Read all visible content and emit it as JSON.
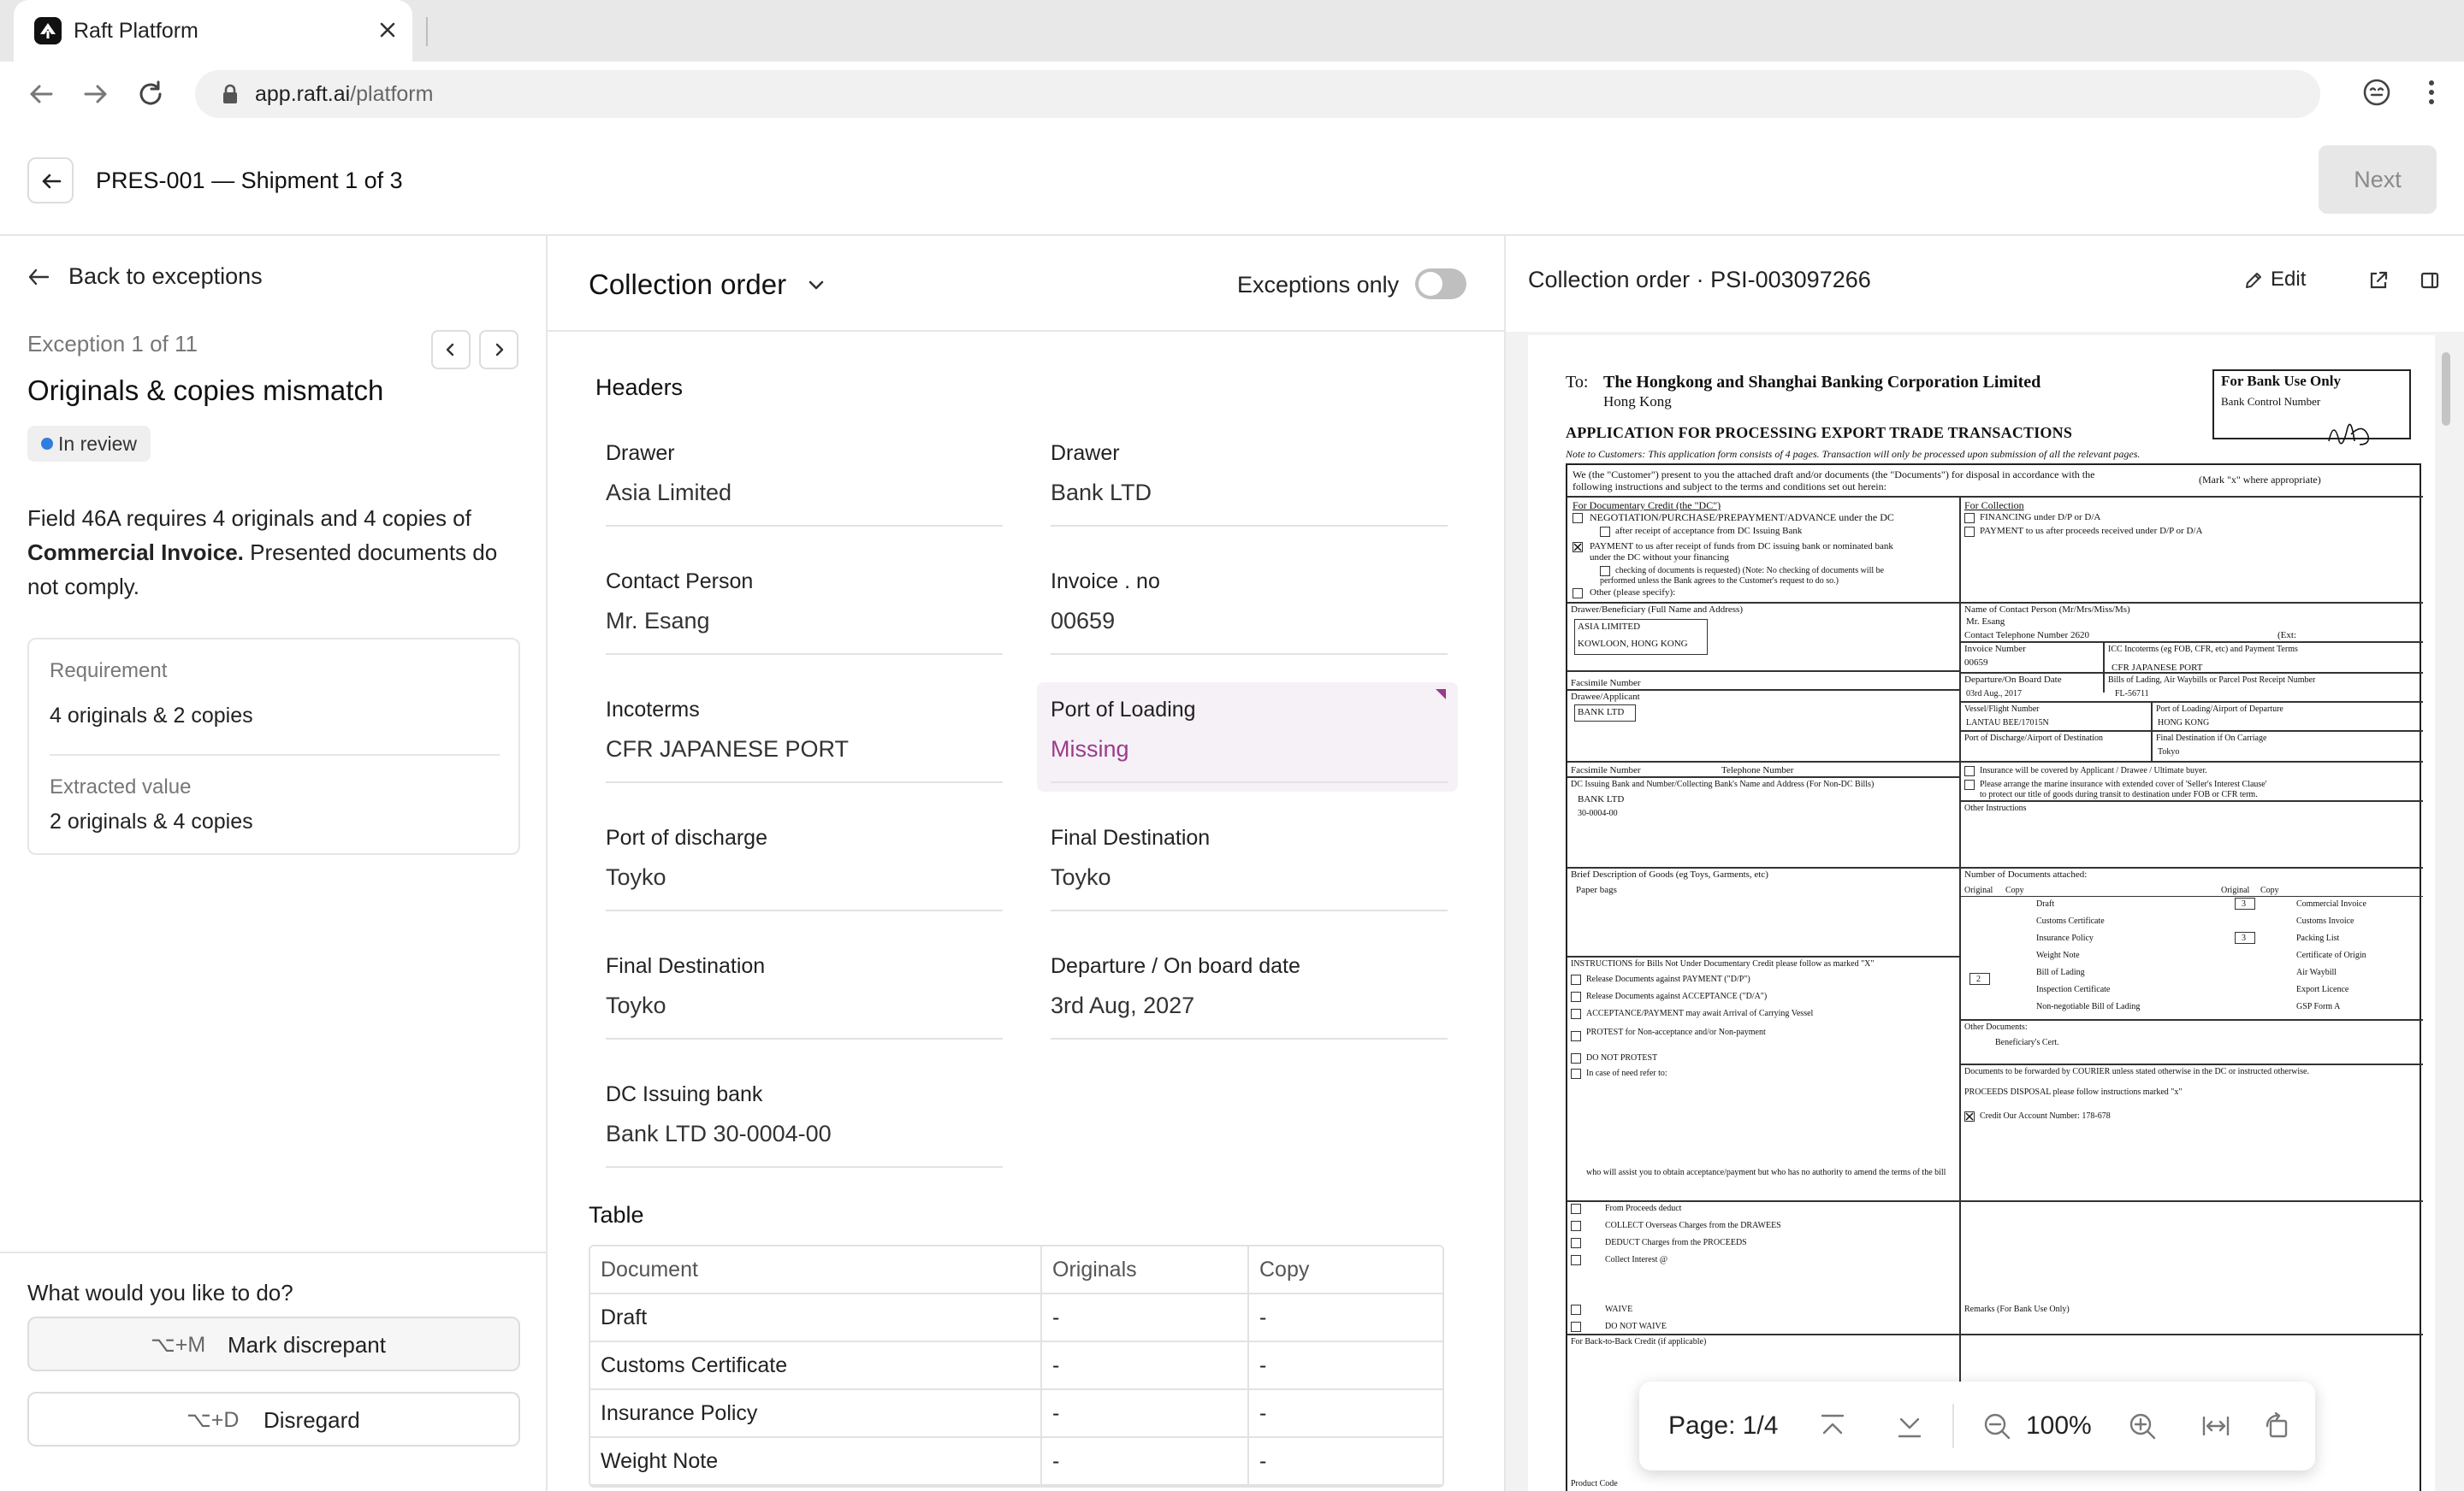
{
  "browser": {
    "tab_title": "Raft Platform",
    "url_host": "app.raft.ai",
    "url_path": "/platform"
  },
  "header": {
    "title": "PRES-001 — Shipment 1 of 3",
    "next_label": "Next"
  },
  "left": {
    "back_label": "Back to exceptions",
    "exception_count": "Exception 1 of 11",
    "exception_title": "Originals & copies mismatch",
    "status": "In review",
    "desc_pre": "Field 46A requires 4 originals and 4 copies of ",
    "desc_bold": "Commercial Invoice.",
    "desc_post": " Presented documents do not comply.",
    "requirement_label": "Requirement",
    "requirement_value": "4 originals & 2 copies",
    "extracted_label": "Extracted value",
    "extracted_value": "2 originals & 4 copies",
    "question": "What would you like to do?",
    "actions": [
      {
        "shortcut": "⌥+M",
        "label": "Mark discrepant"
      },
      {
        "shortcut": "⌥+D",
        "label": "Disregard"
      }
    ]
  },
  "middle": {
    "doc_type": "Collection order",
    "exceptions_only_label": "Exceptions only",
    "exceptions_only": false,
    "headers_title": "Headers",
    "fields": [
      {
        "label": "Drawer",
        "value": "Asia Limited"
      },
      {
        "label": "Drawer",
        "value": "Bank LTD"
      },
      {
        "label": "Contact Person",
        "value": "Mr. Esang"
      },
      {
        "label": "Invoice . no",
        "value": "00659"
      },
      {
        "label": "Incoterms",
        "value": "CFR JAPANESE PORT"
      },
      {
        "label": "Port of Loading",
        "value": "Missing"
      },
      {
        "label": "Port of discharge",
        "value": "Toyko"
      },
      {
        "label": "Final Destination",
        "value": "Toyko"
      },
      {
        "label": "Final Destination",
        "value": "Toyko"
      },
      {
        "label": "Departure / On board date",
        "value": "3rd Aug, 2027"
      },
      {
        "label": "DC Issuing bank",
        "value": "Bank LTD 30-0004-00"
      }
    ],
    "table_title": "Table",
    "table": {
      "columns": [
        "Document",
        "Originals",
        "Copy"
      ],
      "rows": [
        [
          "Draft",
          "-",
          "-"
        ],
        [
          "Customs Certificate",
          "-",
          "-"
        ],
        [
          "Insurance Policy",
          "-",
          "-"
        ],
        [
          "Weight Note",
          "-",
          "-"
        ]
      ]
    }
  },
  "right": {
    "title": "Collection order · PSI-003097266",
    "edit_label": "Edit",
    "page_label": "Page: 1/4",
    "zoom": "100%",
    "pdf": {
      "to": "To:",
      "bank": "The Hongkong and Shanghai Banking Corporation Limited",
      "city": "Hong Kong",
      "bank_use": "For Bank Use Only",
      "bank_control": "Bank Control Number",
      "app_title": "APPLICATION FOR PROCESSING EXPORT TRADE TRANSACTIONS",
      "note": "Note to Customers:   This application form consists of 4 pages.   Transaction will only be processed upon submission of all the relevant pages.",
      "intro1": "We (the \"Customer\") present to you the attached draft and/or documents (the \"Documents\") for disposal in accordance with the",
      "intro2": "following instructions and subject to the terms and conditions set out herein:",
      "mark": "(Mark \"x\" where appropriate)",
      "for_dc": "For Documentary Credit (the \"DC\")",
      "negotiation": "NEGOTIATION/PURCHASE/PREPAYMENT/ADVANCE under the DC",
      "after_receipt": "after receipt of acceptance from DC Issuing Bank",
      "payment_dc": "PAYMENT to us after receipt of funds from DC issuing bank or nominated bank",
      "under_dc": "under the DC without your financing",
      "checking": "checking of documents is requested) (Note: No checking of documents will be",
      "performed": "performed unless the Bank agrees to the Customer's request to do so.)",
      "other": "Other (please specify):",
      "for_collection": "For Collection",
      "financing": "FINANCING under D/P or D/A",
      "payment_coll": "PAYMENT to us after proceeds received under D/P or D/A",
      "drawer_label": "Drawer/Beneficiary (Full Name and Address)",
      "drawer_value1": "ASIA LIMITED",
      "drawer_value2": "KOWLOON, HONG KONG",
      "contact_label": "Name of Contact Person (Mr/Mrs/Miss/Ms)",
      "contact_value": "Mr. Esang",
      "tel_label": "Contact Telephone Number 2620",
      "ext": "(Ext:",
      "invoice_label": "Invoice Number",
      "invoice_value": "00659",
      "icc_label": "ICC Incoterms (eg FOB, CFR, etc) and Payment Terms",
      "icc_value": "CFR JAPANESE PORT",
      "facsimile": "Facsimile Number",
      "departure_label": "Departure/On Board Date",
      "departure_value": "03rd Aug., 2017",
      "bl_label": "Bills of Lading, Air Waybills or Parcel Post Receipt Number",
      "bl_value": "FL-56711",
      "drawee_label": "Drawee/Applicant",
      "drawee_value": "BANK LTD",
      "vessel_label": "Vessel/Flight Number",
      "vessel_value": "LANTAU BEE/17015N",
      "pol_label": "Port of Loading/Airport of Departure",
      "pol_value": "HONG KONG",
      "pod_label": "Port of Discharge/Airport of Destination",
      "final_label": "Final Destination if On Carriage",
      "final_value": "Tokyo",
      "pod_value": "Tokyo",
      "tel_num": "Telephone Number",
      "insurance1": "Insurance will be covered by Applicant / Drawee / Ultimate buyer.",
      "insurance2": "Please arrange the marine insurance with extended cover of 'Seller's Interest Clause'",
      "insurance3": "to protect our title of goods during transit to destination under FOB or CFR term.",
      "dc_issuing_label": "DC Issuing Bank and Number/Collecting Bank's Name and Address (For Non-DC Bills)",
      "dc_issuing_value1": "BANK LTD",
      "dc_issuing_value2": "30-0004-00",
      "other_instr": "Other Instructions",
      "goods_label": "Brief Description of Goods (eg Toys, Garments, etc)",
      "goods_value": "Paper bags",
      "num_docs": "Number of Documents attached:",
      "original": "Original",
      "copy": "Copy",
      "docs_left": [
        "Draft",
        "Customs Certificate",
        "Insurance Policy",
        "Weight Note",
        "Bill of Lading",
        "Inspection Certificate",
        "Non-negotiable Bill of Lading"
      ],
      "docs_right": [
        "Commercial Invoice",
        "Customs Invoice",
        "Packing List",
        "Certificate of Origin",
        "Air Waybill",
        "Export Licence",
        "GSP Form A"
      ],
      "draft_orig": "3",
      "insurance_orig": "3",
      "bol_orig": "2",
      "instructions": "INSTRUCTIONS for Bills Not Under Documentary Credit please follow as marked \"X\"",
      "instr_a": "Release Documents against PAYMENT (\"D/P\")",
      "instr_b": "Release Documents against ACCEPTANCE (\"D/A\")",
      "instr_c": "ACCEPTANCE/PAYMENT may await Arrival of Carrying Vessel",
      "instr_d": "PROTEST for Non-acceptance and/or Non-payment",
      "instr_e": "DO NOT PROTEST",
      "instr_f": "In case of need refer to:",
      "other_docs": "Other Documents:",
      "bene_cert": "Beneficiary's Cert.",
      "courier": "Documents to be forwarded by COURIER unless stated otherwise in the DC or instructed otherwise.",
      "proceeds": "PROCEEDS DISPOSAL please follow instructions marked \"x\"",
      "credit_acct": "Credit Our Account Number: 178-678",
      "assist": "who will assist you to obtain acceptance/payment but who has no authority to amend the terms of the bill",
      "instr_g": "From Proceeds deduct",
      "instr_h": "COLLECT Overseas Charges from the DRAWEES",
      "instr_i": "DEDUCT Charges from the PROCEEDS",
      "instr_j": "Collect Interest @",
      "instr_k": "WAIVE",
      "instr_l": "DO NOT WAIVE",
      "back_to_back": "For Back-to-Back Credit (if applicable)",
      "remarks": "Remarks (For Bank Use Only)",
      "product_code": "Product Code"
    }
  }
}
